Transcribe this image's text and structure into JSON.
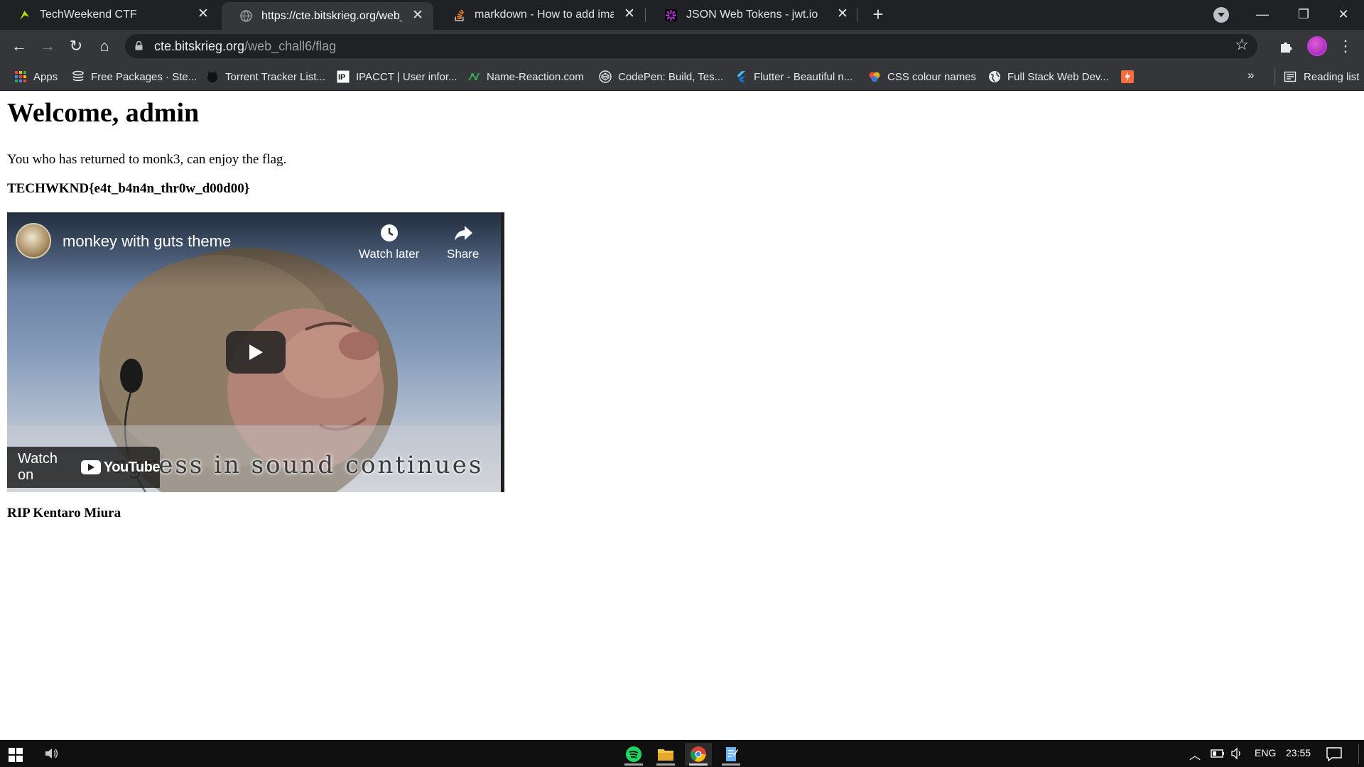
{
  "browser": {
    "tabs": [
      {
        "title": "TechWeekend CTF",
        "close": "✕",
        "favicon_color": "#b8e000"
      },
      {
        "title": "https://cte.bitskrieg.org/web_cha",
        "close": "✕",
        "favicon_color": "#9aa0a6"
      },
      {
        "title": "markdown - How to add images",
        "close": "✕",
        "favicon_color": "#f48024"
      },
      {
        "title": "JSON Web Tokens - jwt.io",
        "close": "✕",
        "favicon_color": "#d63aff"
      }
    ],
    "new_tab": "+",
    "window_controls": {
      "minimize": "—",
      "restore": "❐",
      "close": "✕"
    },
    "toolbar": {
      "back": "←",
      "forward": "→",
      "reload": "↻",
      "home": "⌂",
      "url_host": "cte.bitskrieg.org",
      "url_path": "/web_chall6/flag",
      "star": "☆",
      "menu": "⋮"
    },
    "bookmarks": [
      {
        "label": "Apps",
        "icon": "apps-grid-icon",
        "color": "#e8453c"
      },
      {
        "label": "Free Packages · Ste...",
        "icon": "stack-icon",
        "color": "#e8eaed"
      },
      {
        "label": "Torrent Tracker List...",
        "icon": "cat-icon",
        "color": "#111111"
      },
      {
        "label": "IPACCT | User infor...",
        "icon": "ip-icon",
        "color": "#ffffff"
      },
      {
        "label": "Name-Reaction.com",
        "icon": "molecule-icon",
        "color": "#3aa655"
      },
      {
        "label": "CodePen: Build, Tes...",
        "icon": "codepen-icon",
        "color": "#e8eaed"
      },
      {
        "label": "Flutter - Beautiful n...",
        "icon": "flutter-icon",
        "color": "#44b7f5"
      },
      {
        "label": "CSS colour names",
        "icon": "color-wheel-icon",
        "color": "#e84c3d"
      },
      {
        "label": "Full Stack Web Dev...",
        "icon": "globe-icon",
        "color": "#e8eaed"
      },
      {
        "label": "",
        "icon": "bolt-icon",
        "color": "#f76b3d"
      }
    ],
    "bookmarks_more": "»",
    "reading_list": "Reading list"
  },
  "page": {
    "heading": "Welcome, admin",
    "message": "You who has returned to monk3, can enjoy the flag.",
    "flag": "TECHWKND{e4t_b4n4n_thr0w_d00d00}",
    "footer": "RIP Kentaro Miura"
  },
  "video": {
    "title": "monkey with guts theme",
    "watch_later": "Watch later",
    "share": "Share",
    "watch_on": "Watch on",
    "youtube": "YouTube",
    "caption": "rgress in sound continues"
  },
  "taskbar": {
    "apps": [
      {
        "name": "spotify",
        "color": "#1ed760"
      },
      {
        "name": "file-explorer",
        "color": "#f7c948"
      },
      {
        "name": "chrome",
        "color": "#4285f4"
      },
      {
        "name": "notes",
        "color": "#6ab4f5"
      }
    ],
    "language": "ENG",
    "time": "23:55"
  }
}
